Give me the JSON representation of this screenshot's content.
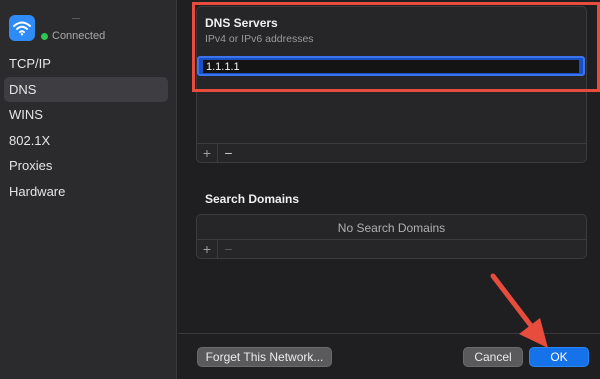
{
  "network": {
    "status": "Connected",
    "icon": "wifi-icon",
    "status_color": "#30c552"
  },
  "sidebar": {
    "items": [
      {
        "label": "TCP/IP",
        "active": false
      },
      {
        "label": "DNS",
        "active": true
      },
      {
        "label": "WINS",
        "active": false
      },
      {
        "label": "802.1X",
        "active": false
      },
      {
        "label": "Proxies",
        "active": false
      },
      {
        "label": "Hardware",
        "active": false
      }
    ]
  },
  "dns_servers": {
    "title": "DNS Servers",
    "subtitle": "IPv4 or IPv6 addresses",
    "entries": [
      "1.1.1.1"
    ],
    "add_label": "+",
    "remove_label": "−"
  },
  "search_domains": {
    "title": "Search Domains",
    "empty_text": "No Search Domains",
    "add_label": "+",
    "remove_label": "−"
  },
  "footer": {
    "forget_label": "Forget This Network...",
    "cancel_label": "Cancel",
    "ok_label": "OK"
  },
  "colors": {
    "accent": "#1572e8",
    "annotation": "#e74c3c"
  }
}
